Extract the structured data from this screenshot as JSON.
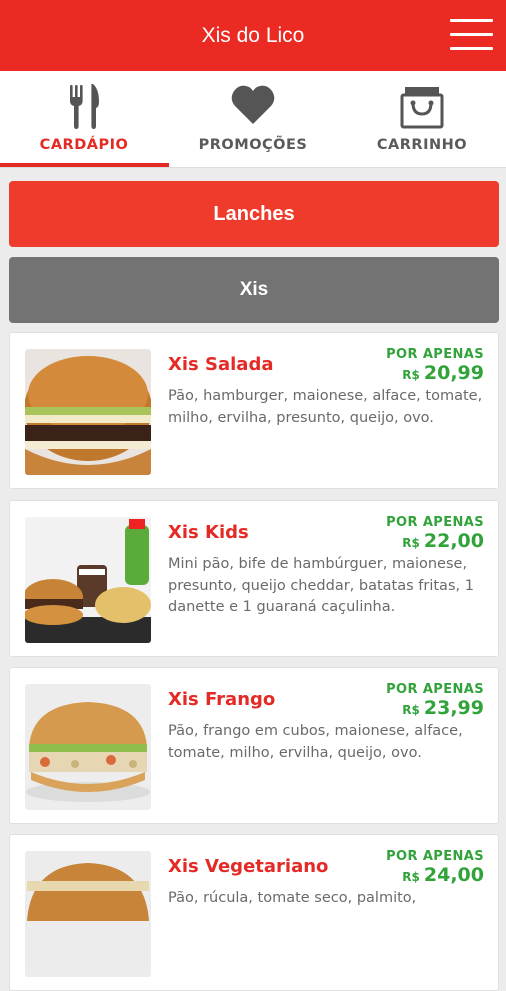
{
  "header": {
    "title": "Xis do Lico",
    "menu_icon": "hamburger-menu-icon"
  },
  "tabs": [
    {
      "label": "CARDÁPIO",
      "icon": "fork-knife-icon",
      "active": true
    },
    {
      "label": "PROMOÇÕES",
      "icon": "heart-icon",
      "active": false
    },
    {
      "label": "CARRINHO",
      "icon": "shopping-bag-icon",
      "active": false
    }
  ],
  "categories": {
    "lanches": "Lanches",
    "xis": "Xis"
  },
  "products": [
    {
      "name": "Xis Salada",
      "promo_label": "POR APENAS",
      "currency": "R$",
      "price": "20,99",
      "description": "Pão, hamburger, maionese, alface, tomate, milho, ervilha, presunto, queijo, ovo."
    },
    {
      "name": "Xis Kids",
      "promo_label": "POR APENAS",
      "currency": "R$",
      "price": "22,00",
      "description": "Mini pão, bife de hambúrguer, maionese, presunto, queijo cheddar, batatas fritas, 1 danette e 1 guaraná caçulinha."
    },
    {
      "name": "Xis Frango",
      "promo_label": "POR APENAS",
      "currency": "R$",
      "price": "23,99",
      "description": "Pão, frango em cubos, maionese, alface, tomate, milho, ervilha, queijo, ovo."
    },
    {
      "name": "Xis Vegetariano",
      "promo_label": "POR APENAS",
      "currency": "R$",
      "price": "24,00",
      "description": "Pão, rúcula, tomate seco, palmito,"
    }
  ],
  "colors": {
    "brand_red": "#ea2a23",
    "price_green": "#31a33a",
    "category_gray": "#737373"
  }
}
